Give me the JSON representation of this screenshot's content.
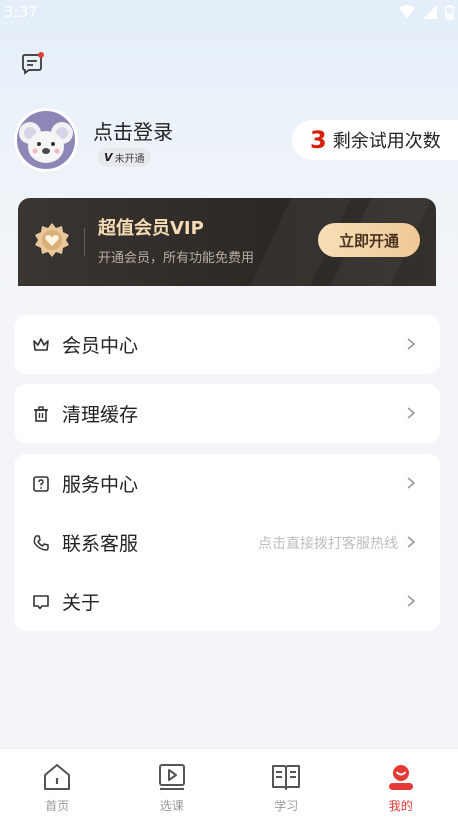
{
  "status_bar": {
    "time": "3:37"
  },
  "profile": {
    "login_text": "点击登录",
    "badge_v": "V",
    "badge_text": "未开通"
  },
  "trial": {
    "count": "3",
    "label": "剩余试用次数"
  },
  "vip": {
    "title": "超值会员VIP",
    "subtitle": "开通会员，所有功能免费用",
    "button": "立即开通"
  },
  "menu": {
    "member_center": "会员中心",
    "clear_cache": "清理缓存",
    "service_center": "服务中心",
    "contact": "联系客服",
    "contact_hint": "点击直接拨打客服热线",
    "about": "关于"
  },
  "tabs": [
    {
      "label": "首页",
      "icon": "home-icon"
    },
    {
      "label": "选课",
      "icon": "course-icon"
    },
    {
      "label": "学习",
      "icon": "book-icon"
    },
    {
      "label": "我的",
      "icon": "profile-icon"
    }
  ],
  "colors": {
    "accent": "#e53935",
    "vip_gold": "#f6dcb5"
  }
}
